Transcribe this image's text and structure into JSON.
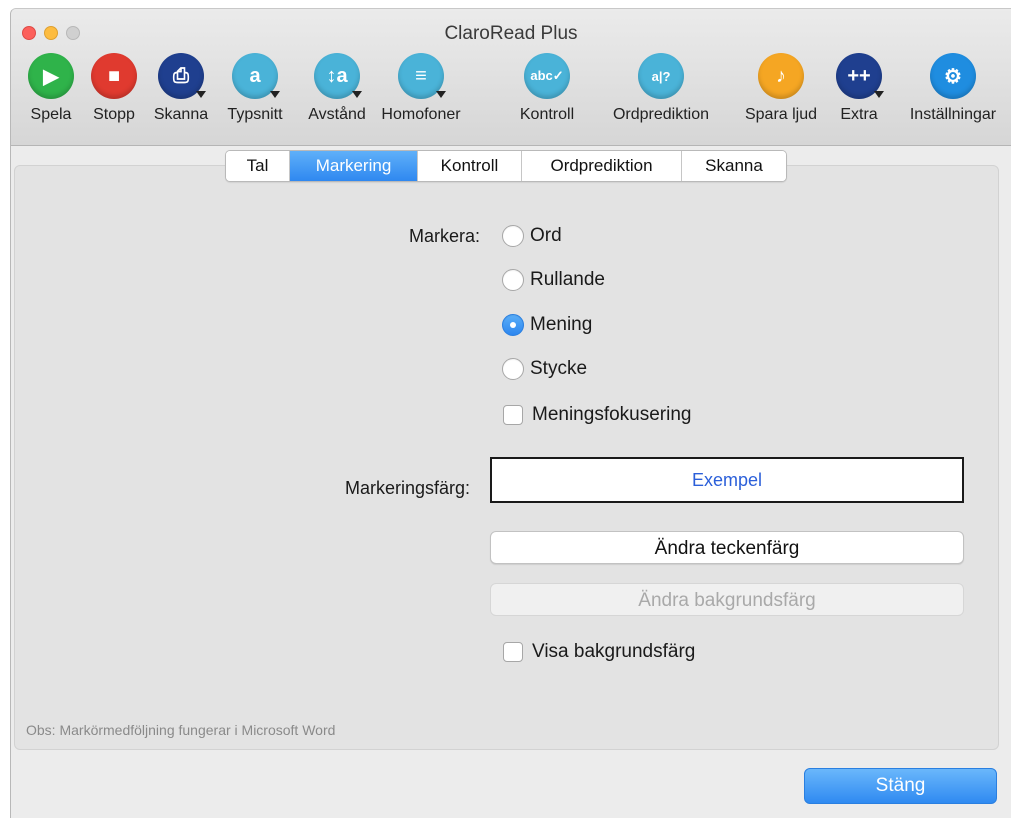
{
  "window": {
    "title": "ClaroRead Plus"
  },
  "toolbar": [
    {
      "label": "Spela",
      "icon": "play-icon",
      "glyph": "▶",
      "color": "#2fb34a",
      "menu": false
    },
    {
      "label": "Stopp",
      "icon": "stop-icon",
      "glyph": "■",
      "color": "#e03a2f",
      "menu": false
    },
    {
      "label": "Skanna",
      "icon": "scanner-icon",
      "glyph": "⎙",
      "color": "#1f3f8f",
      "menu": true
    },
    {
      "label": "Typsnitt",
      "icon": "font-icon",
      "glyph": "a",
      "color": "#4ab3d8",
      "menu": true
    },
    {
      "label": "Avstånd",
      "icon": "spacing-icon",
      "glyph": "↕a",
      "color": "#4ab3d8",
      "menu": true
    },
    {
      "label": "Homofoner",
      "icon": "homophones-icon",
      "glyph": "≡",
      "color": "#4ab3d8",
      "menu": true
    },
    {
      "label": "Kontroll",
      "icon": "spellcheck-icon",
      "glyph": "abc✓",
      "color": "#4ab3d8",
      "menu": false
    },
    {
      "label": "Ordprediktion",
      "icon": "word-prediction-icon",
      "glyph": "a|?",
      "color": "#4ab3d8",
      "menu": false
    },
    {
      "label": "Spara ljud",
      "icon": "save-audio-icon",
      "glyph": "♪",
      "color": "#f5a623",
      "menu": false
    },
    {
      "label": "Extra",
      "icon": "extra-icon",
      "glyph": "++",
      "color": "#1f3f8f",
      "menu": true
    },
    {
      "label": "Inställningar",
      "icon": "settings-gear-icon",
      "glyph": "⚙",
      "color": "#1f8de0",
      "menu": false
    }
  ],
  "tabs": [
    {
      "label": "Tal",
      "active": false
    },
    {
      "label": "Markering",
      "active": true
    },
    {
      "label": "Kontroll",
      "active": false
    },
    {
      "label": "Ordprediktion",
      "active": false
    },
    {
      "label": "Skanna",
      "active": false
    }
  ],
  "highlight": {
    "label": "Markera:",
    "options": [
      {
        "label": "Ord",
        "selected": false
      },
      {
        "label": "Rullande",
        "selected": false
      },
      {
        "label": "Mening",
        "selected": true
      },
      {
        "label": "Stycke",
        "selected": false
      }
    ],
    "sentence_focus": {
      "label": "Meningsfokusering",
      "checked": false
    }
  },
  "color": {
    "label": "Markeringsfärg:",
    "example": "Exempel",
    "change_text_color": "Ändra teckenfärg",
    "change_background_color": "Ändra bakgrundsfärg",
    "show_background": {
      "label": "Visa bakgrundsfärg",
      "checked": false
    }
  },
  "note": "Obs: Markörmedföljning fungerar i Microsoft Word",
  "close_button": "Stäng"
}
